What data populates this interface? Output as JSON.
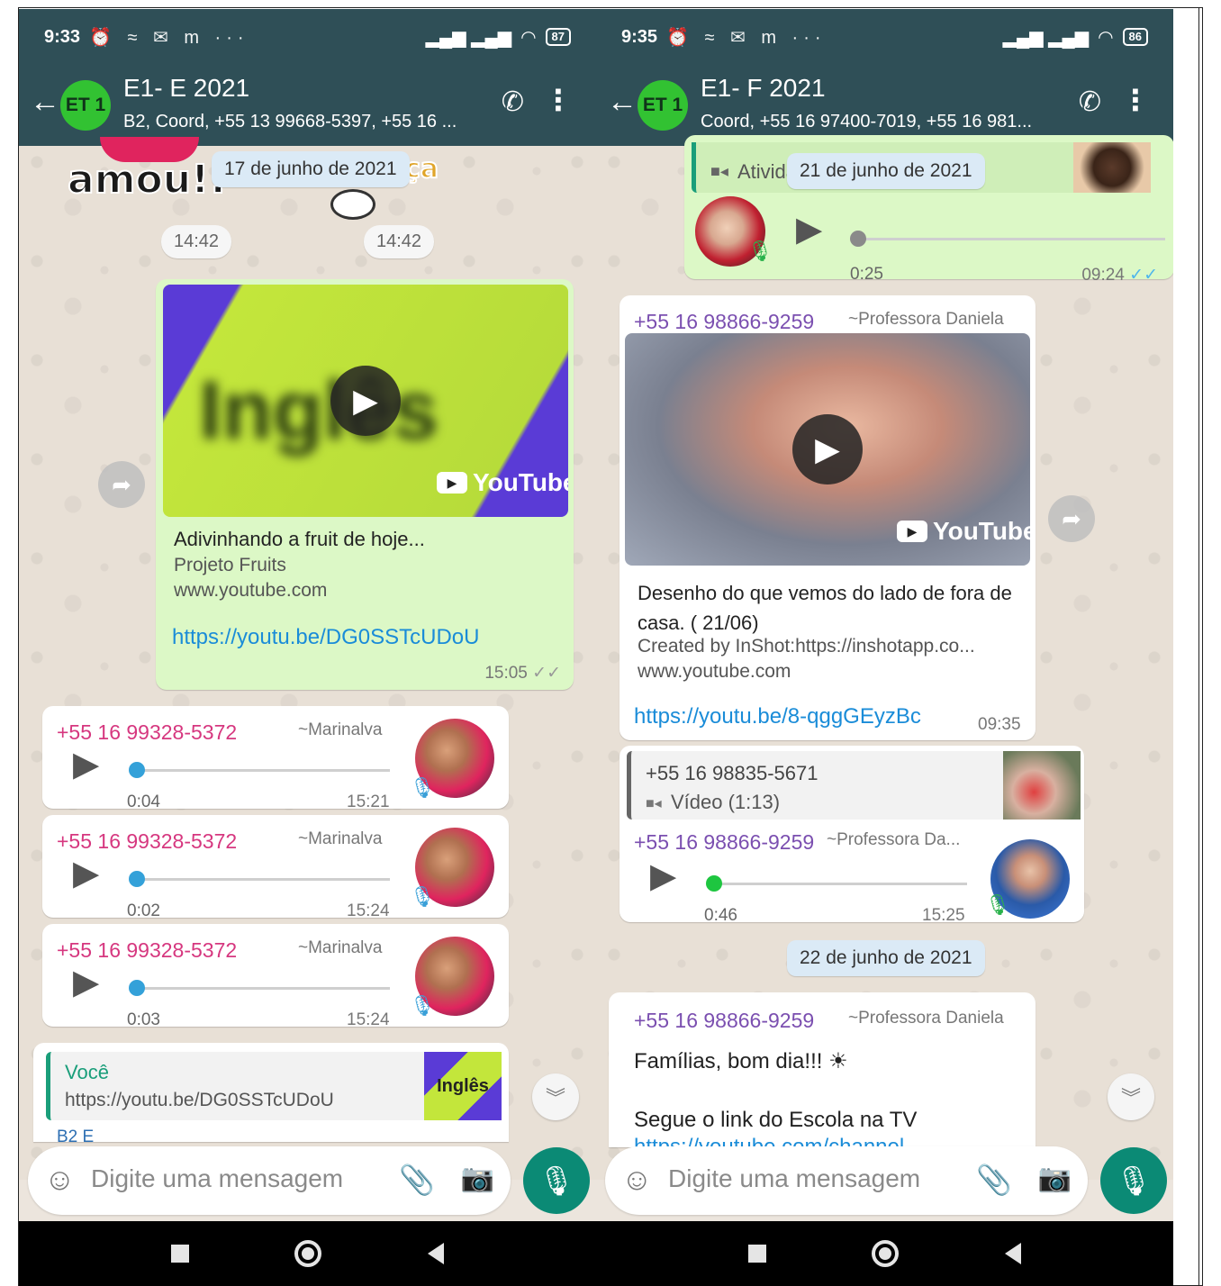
{
  "left": {
    "status": {
      "time": "9:33",
      "battery": "87",
      "icons": "⏰ ≈ ✉ m ···"
    },
    "header": {
      "name": "E1- E 2021",
      "members": "B2, Coord, +55 13 99668-5397, +55 16 ...",
      "avatar_text": "ET 1"
    },
    "sticker_text": "amou!!",
    "sticker_letters": "ça",
    "date_chip": "17 de junho de 2021",
    "time_chips": [
      "14:42",
      "14:42"
    ],
    "link_msg": {
      "thumb_word": "Inglês",
      "yt_label": "YouTube",
      "title": "Adivinhando a fruit de hoje...",
      "channel": "Projeto Fruits",
      "domain": "www.youtube.com",
      "url": "https://youtu.be/DG0SSTcUDoU",
      "time": "15:05"
    },
    "voice_msgs": [
      {
        "sender": "+55 16 99328-5372",
        "alias": "~Marinalva",
        "duration": "0:04",
        "time": "15:21"
      },
      {
        "sender": "+55 16 99328-5372",
        "alias": "~Marinalva",
        "duration": "0:02",
        "time": "15:24"
      },
      {
        "sender": "+55 16 99328-5372",
        "alias": "~Marinalva",
        "duration": "0:03",
        "time": "15:24"
      }
    ],
    "reply_msg": {
      "quoted_sender": "Você",
      "quoted_text": "https://youtu.be/DG0SSTcUDoU",
      "thumb_word": "Inglês",
      "next_sender": "B2 E"
    },
    "input_placeholder": "Digite uma mensagem"
  },
  "right": {
    "status": {
      "time": "9:35",
      "battery": "86",
      "icons": "⏰ ≈ ✉ m ···"
    },
    "header": {
      "name": "E1- F 2021",
      "members": "Coord, +55 16 97400-7019, +55 16 981...",
      "avatar_text": "ET 1"
    },
    "top_bubble": {
      "quoted_text": "Ativida",
      "date_chip": "21 de junho de 2021",
      "duration": "0:25",
      "time": "09:24"
    },
    "link_msg": {
      "sender": "+55 16 98866-9259",
      "alias": "~Professora Daniela",
      "yt_label": "YouTube",
      "title": "Desenho do que vemos do lado de fora de casa. ( 21/06)",
      "desc": "Created by InShot:https://inshotapp.co...",
      "domain": "www.youtube.com",
      "url": "https://youtu.be/8-qggGEyzBc",
      "time": "09:35"
    },
    "reply_voice": {
      "quoted_sender": "+55 16 98835-5671",
      "quoted_text": "Vídeo (1:13)",
      "sender": "+55 16 98866-9259",
      "alias": "~Professora Da...",
      "duration": "0:46",
      "time": "15:25"
    },
    "date_chip_2": "22 de junho de 2021",
    "text_msg": {
      "sender": "+55 16 98866-9259",
      "alias": "~Professora Daniela",
      "line1": "Famílias, bom dia!!! ☀",
      "line2": "Segue o link do Escola na TV",
      "line3": "https://youtube.com/channel"
    },
    "input_placeholder": "Digite uma mensagem"
  },
  "colors": {
    "header": "#2f4f57",
    "outgoing": "#dcf8c6",
    "accent": "#0b8a75",
    "link": "#1a8cd8"
  }
}
